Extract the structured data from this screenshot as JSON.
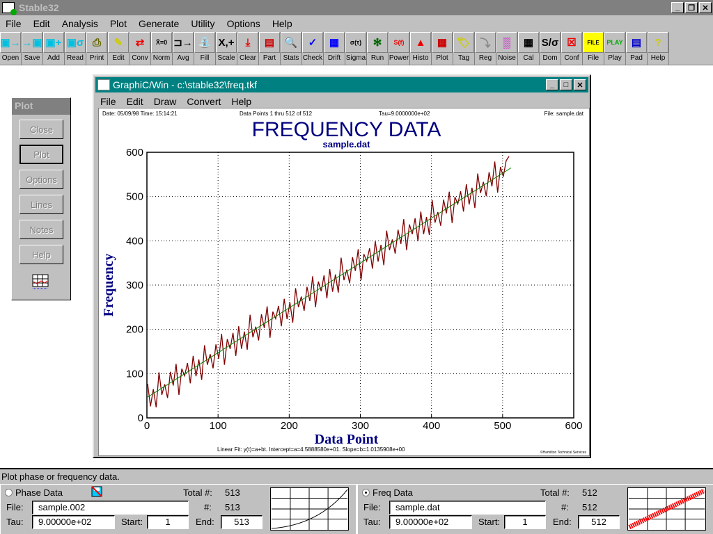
{
  "app": {
    "title": "Stable32"
  },
  "menu": [
    "File",
    "Edit",
    "Analysis",
    "Plot",
    "Generate",
    "Utility",
    "Options",
    "Help"
  ],
  "toolbar": [
    {
      "label": "Open",
      "icon": "disk-open-icon"
    },
    {
      "label": "Save",
      "icon": "disk-save-icon"
    },
    {
      "label": "Add",
      "icon": "disk-add-icon"
    },
    {
      "label": "Read",
      "icon": "disk-read-icon"
    },
    {
      "label": "Print",
      "icon": "printer-icon"
    },
    {
      "label": "Edit",
      "icon": "pencil-icon"
    },
    {
      "label": "Conv",
      "icon": "convert-arrows-icon"
    },
    {
      "label": "Norm",
      "icon": "normalize-icon"
    },
    {
      "label": "Avg",
      "icon": "average-icon"
    },
    {
      "label": "Fill",
      "icon": "faucet-icon"
    },
    {
      "label": "Scale",
      "icon": "scale-icon"
    },
    {
      "label": "Clear",
      "icon": "clear-icon"
    },
    {
      "label": "Part",
      "icon": "part-icon"
    },
    {
      "label": "Stats",
      "icon": "magnifier-icon"
    },
    {
      "label": "Check",
      "icon": "checkmark-icon"
    },
    {
      "label": "Drift",
      "icon": "drift-icon"
    },
    {
      "label": "Sigma",
      "icon": "sigma-tau-icon"
    },
    {
      "label": "Run",
      "icon": "gears-icon"
    },
    {
      "label": "Power",
      "icon": "power-spectrum-icon"
    },
    {
      "label": "Histo",
      "icon": "histogram-icon"
    },
    {
      "label": "Plot",
      "icon": "plot-icon"
    },
    {
      "label": "Tag",
      "icon": "tag-icon"
    },
    {
      "label": "Reg",
      "icon": "regression-icon"
    },
    {
      "label": "Noise",
      "icon": "noise-icon"
    },
    {
      "label": "Cal",
      "icon": "calendar-icon"
    },
    {
      "label": "Dom",
      "icon": "domain-icon"
    },
    {
      "label": "Conf",
      "icon": "confidence-icon"
    },
    {
      "label": "File",
      "icon": "file-folder-icon"
    },
    {
      "label": "Play",
      "icon": "play-graphic-icon"
    },
    {
      "label": "Pad",
      "icon": "notepad-icon"
    },
    {
      "label": "Help",
      "icon": "question-icon"
    }
  ],
  "icon_glyphs": [
    "▣→",
    "→▣",
    "▣+",
    "▣σ",
    "⎙",
    "✎",
    "⇄",
    "X̄=0",
    "⊐→",
    "⛲",
    "X,+",
    "⤓",
    "▤",
    "🔍",
    "✓",
    "▦",
    "σ(τ)",
    "✻",
    "S(f)",
    "▲",
    "▦",
    "🏷",
    "⤵",
    "▒",
    "▦",
    "S/σ",
    "☒",
    "FILE",
    "PLAY",
    "▤",
    "?"
  ],
  "plot_dialog": {
    "title": "Plot",
    "buttons": [
      "Close",
      "Plot",
      "Options",
      "Lines",
      "Notes",
      "Help"
    ]
  },
  "graphic_window": {
    "title": "GraphiC/Win - c:\\stable32\\freq.tkf",
    "menu": [
      "File",
      "Edit",
      "Draw",
      "Convert",
      "Help"
    ]
  },
  "plot_header": {
    "date": "Date: 05/09/98  Time: 15:14:21",
    "points": "Data Points 1 thru 512 of 512",
    "tau": "Tau=9.0000000e+02",
    "file": "File: sample.dat"
  },
  "plot_footer": {
    "fit": "Linear Fit: y(t)=a+bt. Intercept=a=4.5888580e+01. Slope=b=1.0135908e+00",
    "credit": "©Hamilton Technical Services"
  },
  "chart_data": {
    "type": "line",
    "title": "FREQUENCY DATA",
    "subtitle": "sample.dat",
    "xlabel": "Data Point",
    "ylabel": "Frequency",
    "xlim": [
      0,
      600
    ],
    "ylim": [
      0,
      600
    ],
    "xticks": [
      0,
      100,
      200,
      300,
      400,
      500,
      600
    ],
    "yticks": [
      0,
      100,
      200,
      300,
      400,
      500,
      600
    ],
    "grid": true,
    "colors": {
      "data": "#800000",
      "fit": "#008000",
      "title": "#000080"
    },
    "x_start": 1,
    "x_step": 4,
    "values": [
      77,
      26,
      65,
      24,
      103,
      52,
      76,
      45,
      104,
      73,
      122,
      52,
      111,
      95,
      124,
      78,
      140,
      94,
      132,
      86,
      164,
      120,
      144,
      112,
      166,
      134,
      190,
      120,
      178,
      156,
      192,
      140,
      207,
      156,
      195,
      154,
      233,
      182,
      206,
      175,
      234,
      203,
      252,
      181,
      240,
      224,
      253,
      207,
      269,
      223,
      261,
      215,
      293,
      250,
      274,
      242,
      296,
      264,
      320,
      250,
      308,
      286,
      322,
      270,
      336,
      285,
      324,
      283,
      362,
      311,
      335,
      304,
      363,
      332,
      381,
      311,
      370,
      354,
      383,
      337,
      399,
      353,
      391,
      345,
      423,
      379,
      403,
      371,
      425,
      393,
      449,
      379,
      437,
      415,
      451,
      399,
      466,
      415,
      454,
      413,
      492,
      441,
      465,
      434,
      493,
      462,
      511,
      440,
      499,
      483,
      512,
      466,
      528,
      482,
      520,
      474,
      552,
      508,
      533,
      501,
      555,
      523,
      579,
      509,
      567,
      545,
      581,
      591
    ],
    "fit": {
      "intercept": 45.88858,
      "slope": 1.0135908
    }
  },
  "status": "Plot phase or frequency data.",
  "phase": {
    "label": "Phase Data",
    "file_label": "File:",
    "file": "sample.002",
    "tau_label": "Tau:",
    "tau": "9.00000e+02",
    "start_label": "Start:",
    "start": "1",
    "end_label": "End:",
    "end": "513",
    "total_label": "Total #:",
    "total": "513",
    "count_label": "#:",
    "count": "513",
    "selected": false
  },
  "freq": {
    "label": "Freq Data",
    "file_label": "File:",
    "file": "sample.dat",
    "tau_label": "Tau:",
    "tau": "9.00000e+02",
    "start_label": "Start:",
    "start": "1",
    "end_label": "End:",
    "end": "512",
    "total_label": "Total #:",
    "total": "512",
    "count_label": "#:",
    "count": "512",
    "selected": true
  }
}
